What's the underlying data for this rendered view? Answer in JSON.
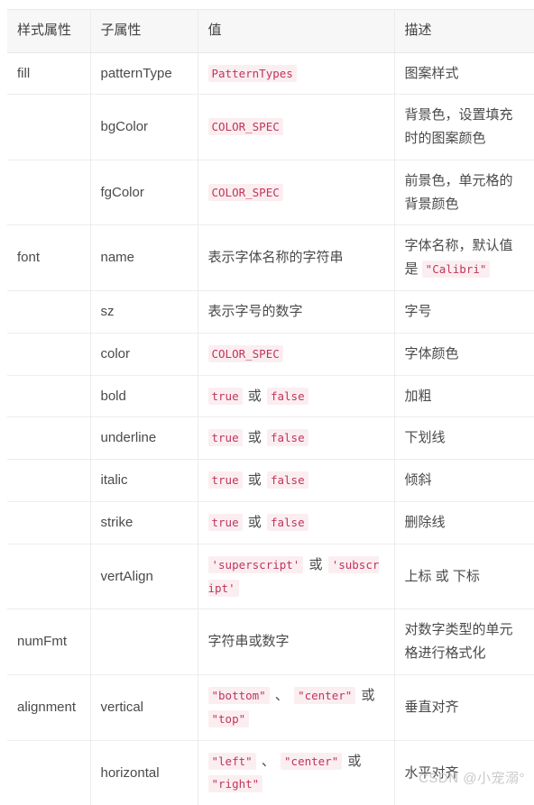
{
  "table": {
    "headers": [
      "样式属性",
      "子属性",
      "值",
      "描述"
    ],
    "rows": [
      {
        "attr": "fill",
        "sub": "patternType",
        "value_parts": [
          {
            "type": "code",
            "text": "PatternTypes"
          }
        ],
        "desc_parts": [
          {
            "type": "text",
            "text": "图案样式"
          }
        ]
      },
      {
        "attr": "",
        "sub": "bgColor",
        "value_parts": [
          {
            "type": "code",
            "text": "COLOR_SPEC"
          }
        ],
        "desc_parts": [
          {
            "type": "text",
            "text": "背景色，设置填充时的图案颜色"
          }
        ]
      },
      {
        "attr": "",
        "sub": "fgColor",
        "value_parts": [
          {
            "type": "code",
            "text": "COLOR_SPEC"
          }
        ],
        "desc_parts": [
          {
            "type": "text",
            "text": "前景色，单元格的背景颜色"
          }
        ]
      },
      {
        "attr": "font",
        "sub": "name",
        "value_parts": [
          {
            "type": "text",
            "text": "表示字体名称的字符串"
          }
        ],
        "desc_parts": [
          {
            "type": "text",
            "text": "字体名称，默认值是 "
          },
          {
            "type": "code",
            "text": "\"Calibri\""
          }
        ]
      },
      {
        "attr": "",
        "sub": "sz",
        "value_parts": [
          {
            "type": "text",
            "text": "表示字号的数字"
          }
        ],
        "desc_parts": [
          {
            "type": "text",
            "text": "字号"
          }
        ]
      },
      {
        "attr": "",
        "sub": "color",
        "value_parts": [
          {
            "type": "code",
            "text": "COLOR_SPEC"
          }
        ],
        "desc_parts": [
          {
            "type": "text",
            "text": "字体颜色"
          }
        ]
      },
      {
        "attr": "",
        "sub": "bold",
        "value_parts": [
          {
            "type": "code",
            "text": "true"
          },
          {
            "type": "sep",
            "text": "或"
          },
          {
            "type": "code",
            "text": "false"
          }
        ],
        "desc_parts": [
          {
            "type": "text",
            "text": "加粗"
          }
        ]
      },
      {
        "attr": "",
        "sub": "underline",
        "value_parts": [
          {
            "type": "code",
            "text": "true"
          },
          {
            "type": "sep",
            "text": "或"
          },
          {
            "type": "code",
            "text": "false"
          }
        ],
        "desc_parts": [
          {
            "type": "text",
            "text": "下划线"
          }
        ]
      },
      {
        "attr": "",
        "sub": "italic",
        "value_parts": [
          {
            "type": "code",
            "text": "true"
          },
          {
            "type": "sep",
            "text": "或"
          },
          {
            "type": "code",
            "text": "false"
          }
        ],
        "desc_parts": [
          {
            "type": "text",
            "text": "倾斜"
          }
        ]
      },
      {
        "attr": "",
        "sub": "strike",
        "value_parts": [
          {
            "type": "code",
            "text": "true"
          },
          {
            "type": "sep",
            "text": "或"
          },
          {
            "type": "code",
            "text": "false"
          }
        ],
        "desc_parts": [
          {
            "type": "text",
            "text": "删除线"
          }
        ]
      },
      {
        "attr": "",
        "sub": "vertAlign",
        "value_parts": [
          {
            "type": "code",
            "text": "'superscript'"
          },
          {
            "type": "sep",
            "text": "或"
          },
          {
            "type": "code",
            "text": "'subscript'"
          }
        ],
        "desc_parts": [
          {
            "type": "text",
            "text": "上标 或 下标"
          }
        ]
      },
      {
        "attr": "numFmt",
        "sub": "",
        "value_parts": [
          {
            "type": "text",
            "text": "字符串或数字"
          }
        ],
        "desc_parts": [
          {
            "type": "text",
            "text": "对数字类型的单元格进行格式化"
          }
        ]
      },
      {
        "attr": "alignment",
        "sub": "vertical",
        "value_parts": [
          {
            "type": "code",
            "text": "\"bottom\""
          },
          {
            "type": "sep",
            "text": "、"
          },
          {
            "type": "code",
            "text": "\"center\""
          },
          {
            "type": "sep",
            "text": "或"
          },
          {
            "type": "code",
            "text": "\"top\""
          }
        ],
        "desc_parts": [
          {
            "type": "text",
            "text": "垂直对齐"
          }
        ]
      },
      {
        "attr": "",
        "sub": "horizontal",
        "value_parts": [
          {
            "type": "code",
            "text": "\"left\""
          },
          {
            "type": "sep",
            "text": "、"
          },
          {
            "type": "code",
            "text": "\"center\""
          },
          {
            "type": "sep",
            "text": "或"
          },
          {
            "type": "code",
            "text": "\"right\""
          }
        ],
        "desc_parts": [
          {
            "type": "text",
            "text": "水平对齐"
          }
        ]
      }
    ]
  },
  "watermark": {
    "text": "CSDN @小宠溺°"
  },
  "colors": {
    "header_bg": "#f7f7f7",
    "border": "#ececec",
    "code_bg": "#fbeef1",
    "code_fg": "#c0355c",
    "text": "#4a4a4a",
    "watermark": "#c9c9c9"
  }
}
